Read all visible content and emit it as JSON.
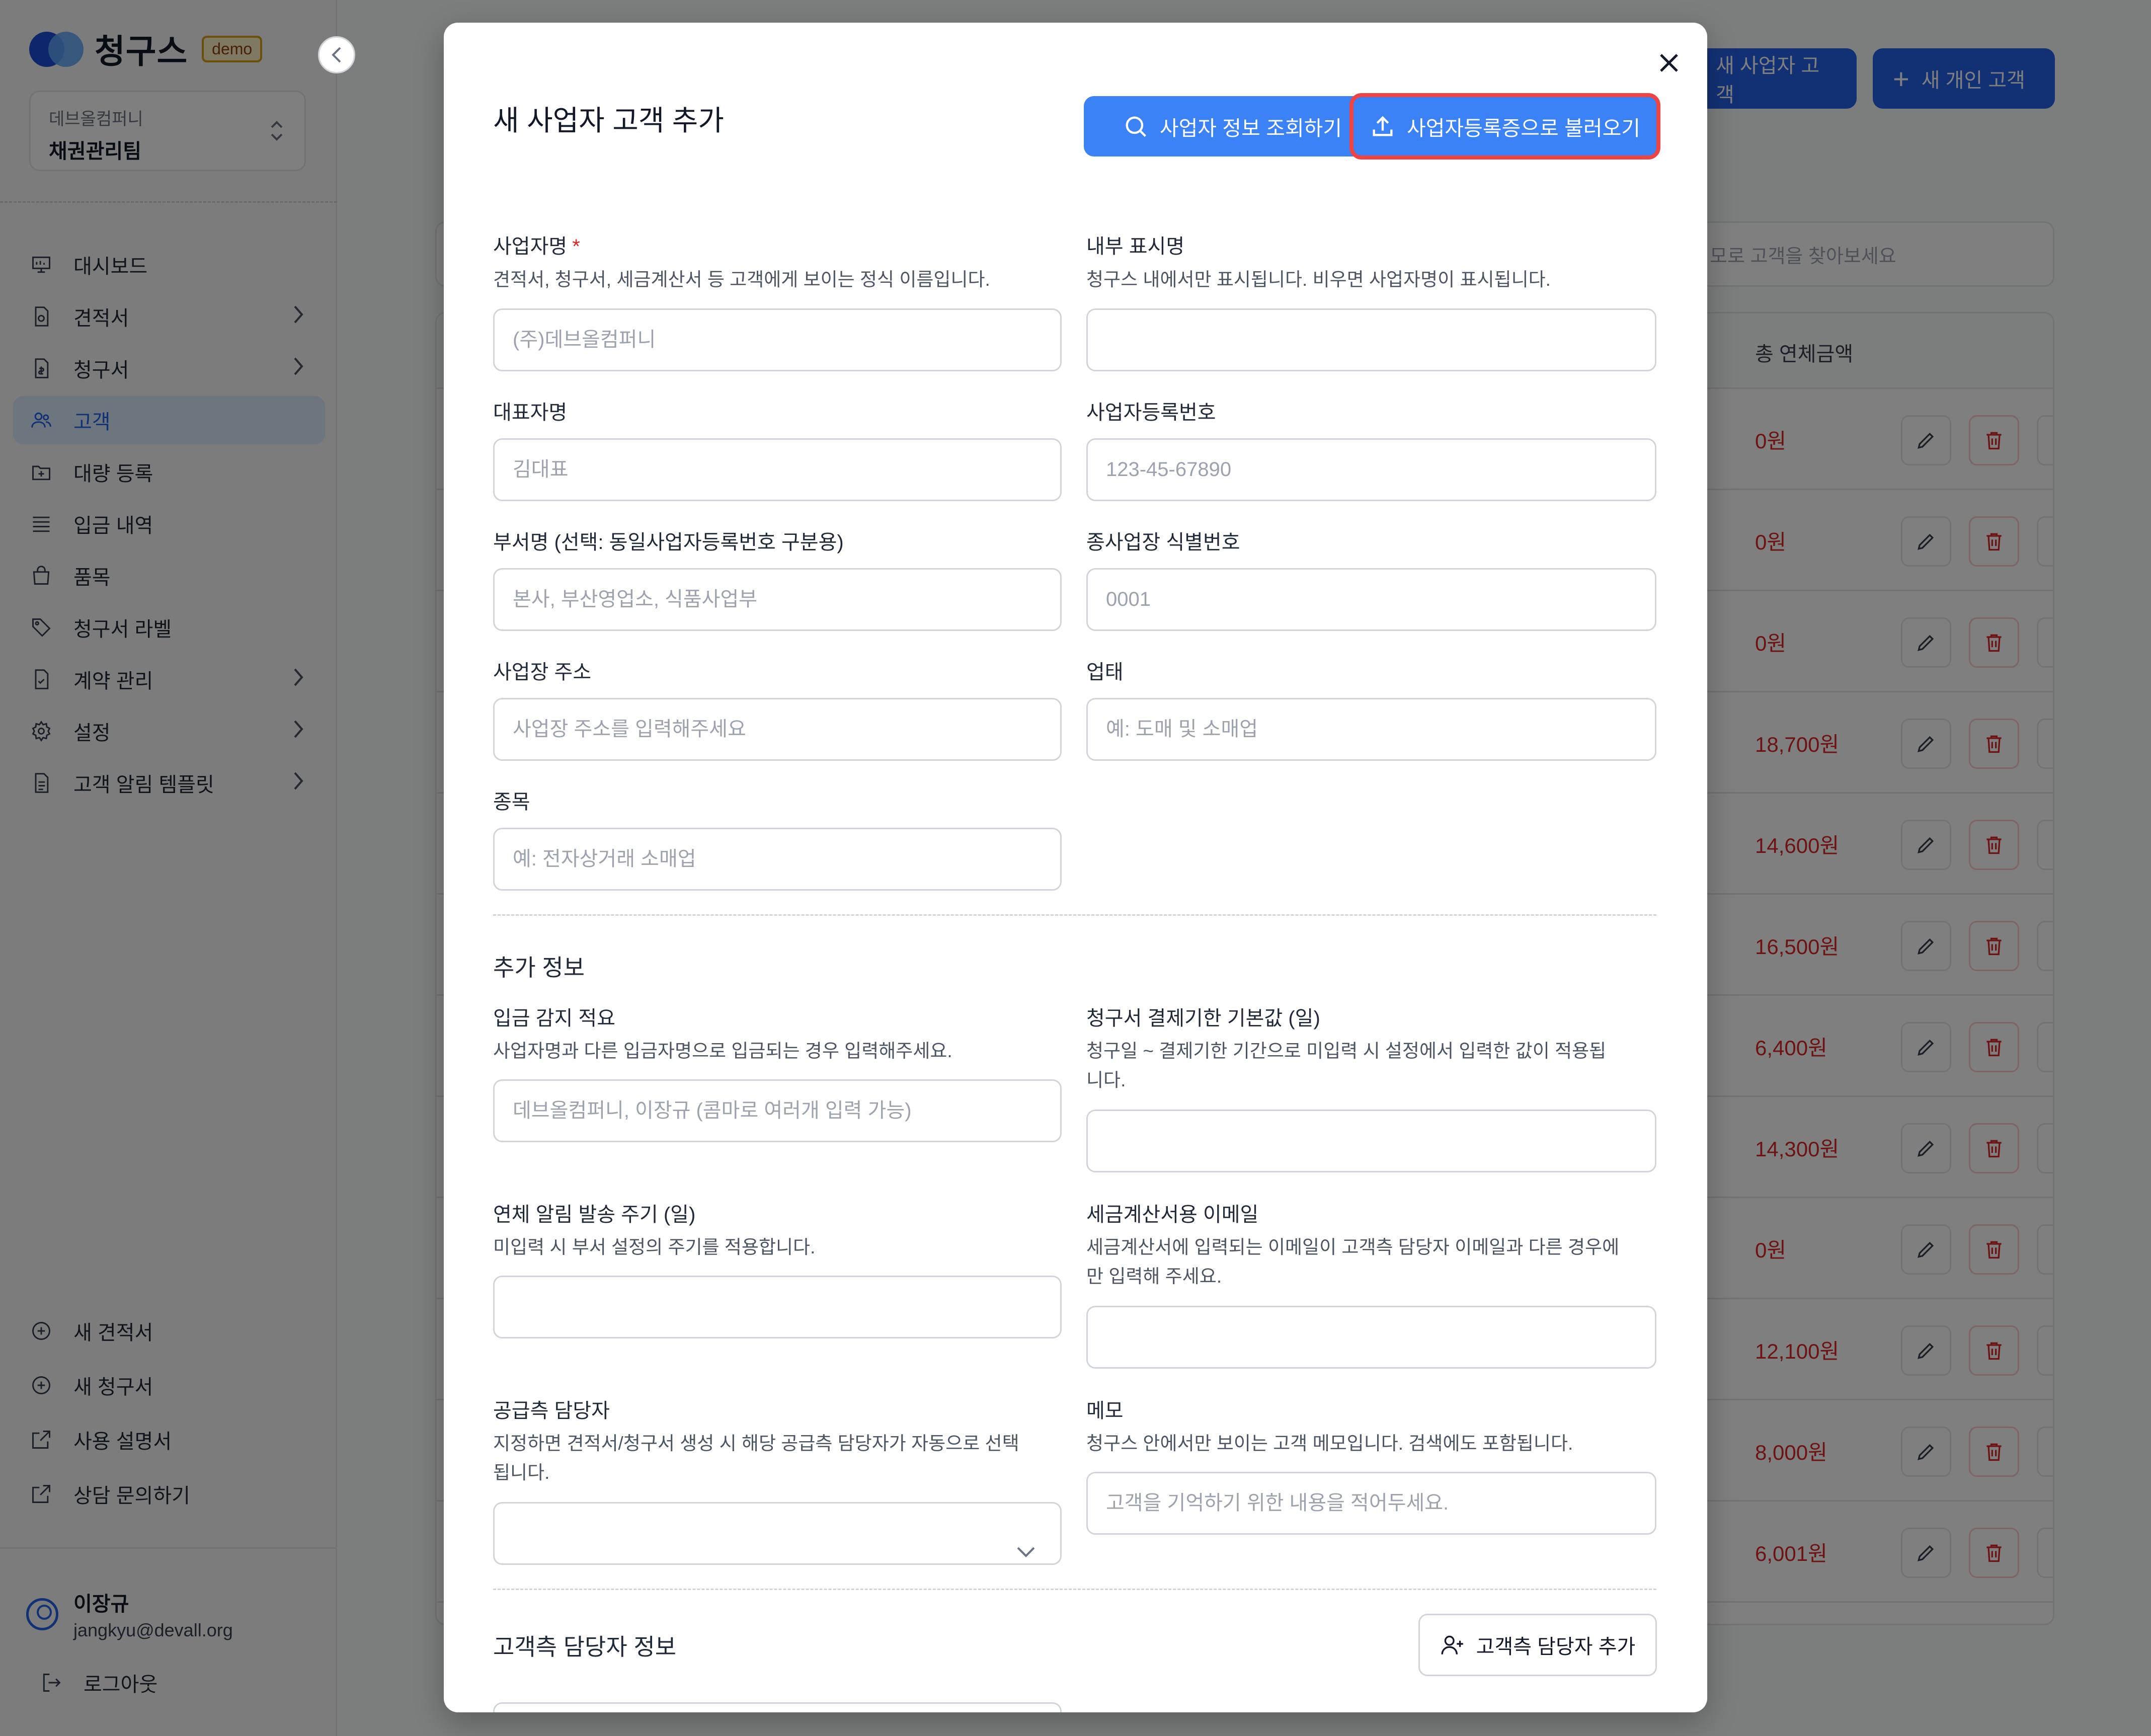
{
  "sidebar": {
    "brand_name": "청구스",
    "demo_badge": "demo",
    "org": {
      "company": "데브올컴퍼니",
      "team": "채권관리팀"
    },
    "nav": [
      {
        "label": "대시보드",
        "icon": "dashboard-icon",
        "chevron": false,
        "active": false
      },
      {
        "label": "견적서",
        "icon": "quote-document-icon",
        "chevron": true,
        "active": false
      },
      {
        "label": "청구서",
        "icon": "invoice-document-icon",
        "chevron": true,
        "active": false
      },
      {
        "label": "고객",
        "icon": "users-icon",
        "chevron": false,
        "active": true
      },
      {
        "label": "대량 등록",
        "icon": "folder-plus-icon",
        "chevron": false,
        "active": false
      },
      {
        "label": "입금 내역",
        "icon": "list-icon",
        "chevron": false,
        "active": false
      },
      {
        "label": "품목",
        "icon": "shopping-bag-icon",
        "chevron": false,
        "active": false
      },
      {
        "label": "청구서 라벨",
        "icon": "tag-icon",
        "chevron": false,
        "active": false
      },
      {
        "label": "계약 관리",
        "icon": "contract-icon",
        "chevron": true,
        "active": false
      },
      {
        "label": "설정",
        "icon": "gear-icon",
        "chevron": true,
        "active": false
      },
      {
        "label": "고객 알림 템플릿",
        "icon": "template-icon",
        "chevron": true,
        "active": false
      }
    ],
    "bottom_nav": [
      {
        "label": "새 견적서",
        "icon": "plus-circle-icon"
      },
      {
        "label": "새 청구서",
        "icon": "plus-circle-icon"
      },
      {
        "label": "사용 설명서",
        "icon": "external-link-icon"
      },
      {
        "label": "상담 문의하기",
        "icon": "external-link-icon"
      }
    ],
    "user": {
      "name": "이장규",
      "email": "jangkyu@devall.org"
    },
    "logout_label": "로그아웃"
  },
  "background": {
    "new_business_button": "새 사업자 고객",
    "new_individual_button": "새 개인 고객",
    "search_placeholder": "모로 고객을 찾아보세요",
    "column_overdue": "총 연체금액",
    "rows": [
      "0원",
      "0원",
      "0원",
      "18,700원",
      "14,600원",
      "16,500원",
      "6,400원",
      "14,300원",
      "0원",
      "12,100원",
      "8,000원",
      "6,001원"
    ]
  },
  "modal": {
    "title": "새 사업자 고객 추가",
    "lookup_button": "사업자 정보 조회하기",
    "upload_button": "사업자등록증으로 불러오기",
    "fields": {
      "business_name": {
        "label": "사업자명",
        "required_mark": "*",
        "description": "견적서, 청구서, 세금계산서 등 고객에게 보이는 정식 이름입니다.",
        "placeholder": "(주)데브올컴퍼니"
      },
      "display_name": {
        "label": "내부 표시명",
        "description": "청구스 내에서만 표시됩니다. 비우면 사업자명이 표시됩니다.",
        "placeholder": ""
      },
      "representative": {
        "label": "대표자명",
        "placeholder": "김대표"
      },
      "registration_number": {
        "label": "사업자등록번호",
        "placeholder": "123-45-67890"
      },
      "department": {
        "label": "부서명 (선택: 동일사업자등록번호 구분용)",
        "placeholder": "본사, 부산영업소, 식품사업부"
      },
      "branch_id": {
        "label": "종사업장 식별번호",
        "placeholder": "0001"
      },
      "address": {
        "label": "사업장 주소",
        "placeholder": "사업장 주소를 입력해주세요"
      },
      "business_type": {
        "label": "업태",
        "placeholder": "예: 도매 및 소매업"
      },
      "business_item": {
        "label": "종목",
        "placeholder": "예: 전자상거래 소매업"
      }
    },
    "extra_section_title": "추가 정보",
    "extra": {
      "deposit_memo": {
        "label": "입금 감지 적요",
        "description": "사업자명과 다른 입금자명으로 입금되는 경우 입력해주세요.",
        "placeholder": "데브올컴퍼니, 이장규 (콤마로 여러개 입력 가능)"
      },
      "payment_term": {
        "label": "청구서 결제기한 기본값 (일)",
        "description_line1": "청구일 ~ 결제기한 기간으로 미입력 시 설정에서 입력한 값이 적용됩",
        "description_line2": "니다.",
        "placeholder": ""
      },
      "overdue_cycle": {
        "label": "연체 알림 발송 주기 (일)",
        "description": "미입력 시 부서 설정의 주기를 적용합니다.",
        "placeholder": ""
      },
      "tax_email": {
        "label": "세금계산서용 이메일",
        "description_line1": "세금계산서에 입력되는 이메일이 고객측 담당자 이메일과 다른 경우에",
        "description_line2": "만 입력해 주세요.",
        "placeholder": ""
      },
      "supplier_manager": {
        "label": "공급측 담당자",
        "description_line1": "지정하면 견적서/청구서 생성 시 해당 공급측 담당자가 자동으로 선택",
        "description_line2": "됩니다.",
        "selected": ""
      },
      "memo": {
        "label": "메모",
        "description": "청구스 안에서만 보이는 고객 메모입니다. 검색에도 포함됩니다.",
        "placeholder": "고객을 기억하기 위한 내용을 적어두세요."
      }
    },
    "contact_section_title": "고객측 담당자 정보",
    "add_contact_button": "고객측 담당자 추가"
  }
}
